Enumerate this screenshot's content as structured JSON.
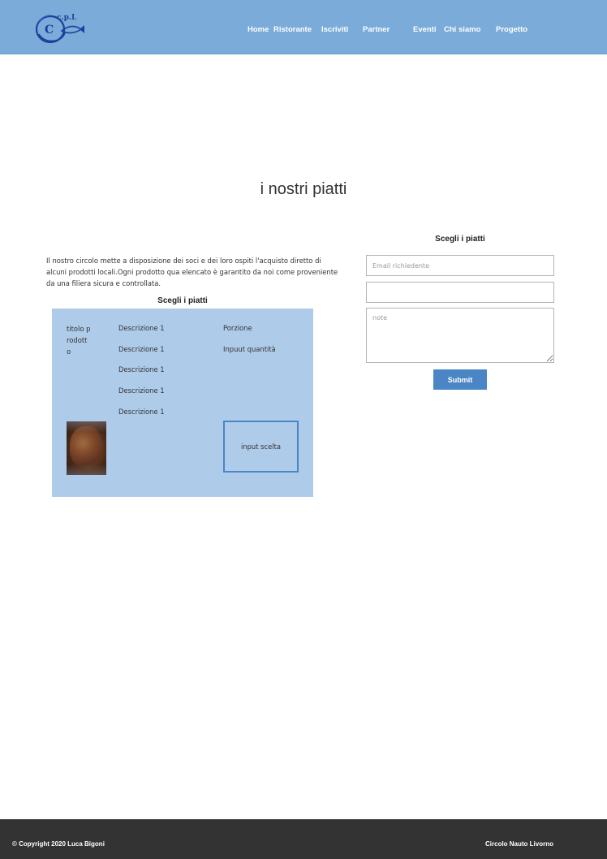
{
  "header": {
    "logo_text": "c.p.L",
    "logo_letter": "C",
    "nav": [
      "Home",
      "Ristorante",
      "Iscriviti",
      "Partner",
      "Eventi",
      "Chi siamo",
      "Progetto"
    ]
  },
  "main": {
    "title": "i nostri piatti",
    "intro": "Il nostro circolo mette a disposizione dei soci e dei loro ospiti l'acquisto diretto di alcuni prodotti locali.Ogni prodotto qua elencato è garantito da noi come proveniente da una filiera sicura e controllata.",
    "menu_heading": "Scegli i piatti",
    "card": {
      "product_title": "titolo prodotto",
      "descriptions": [
        "Descrizione 1",
        "Descrizione 1",
        "Descrizione 1",
        "Descrizione 1",
        "Descrizione 1"
      ],
      "portion_label": "Porzione",
      "quantity_label": "Inpuut quantità",
      "choice_label": "input scelta"
    }
  },
  "form": {
    "heading": "Scegli i piatti",
    "email_placeholder": "Email richiedente",
    "second_value": "",
    "note_placeholder": "note",
    "submit_label": "Submit"
  },
  "footer": {
    "copyright": "© Copyright 2020 Luca Bigoni",
    "org": "Circolo Nauto Livorno"
  },
  "colors": {
    "header_bg": "#7aabd9",
    "card_bg": "#aecbea",
    "accent": "#4a86c5",
    "footer_bg": "#333333"
  }
}
